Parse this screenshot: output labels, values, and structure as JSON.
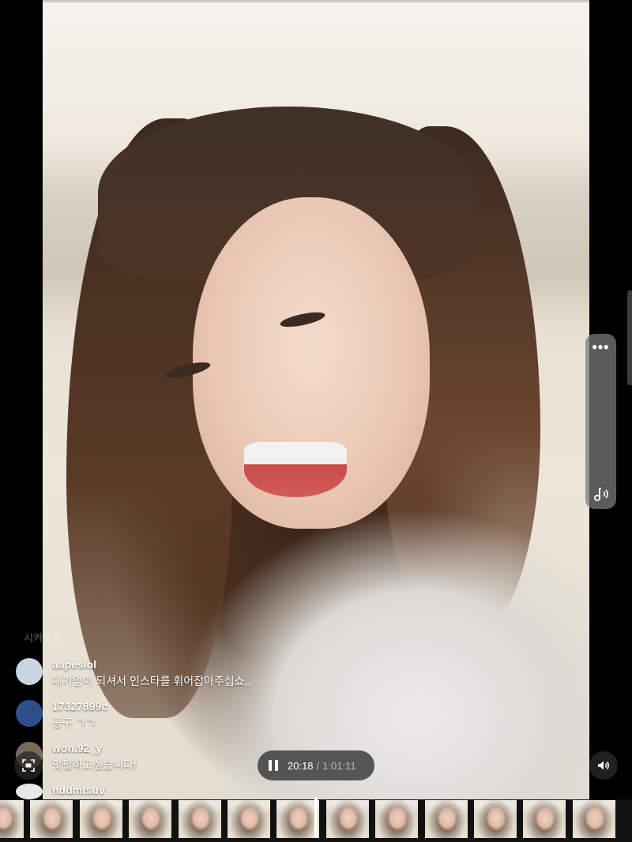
{
  "comments_faded": "시켜해요",
  "comments": [
    {
      "username": "aapeslol",
      "message": "대기업이 되셔서 인스타를 휘어잡아주십쇼,,",
      "avatar_color": "#c9d6e2"
    },
    {
      "username": "17327899c",
      "message": "공구 ㄱㄱ",
      "avatar_color": "#2f4f8a"
    },
    {
      "username": "won.92_y",
      "message": "맛팔하고싶습니다!",
      "avatar_color": "#7a6a5a"
    },
    {
      "username": "nddmtsuv",
      "message": "",
      "avatar_color": "#e8e8e8"
    }
  ],
  "player": {
    "current_time": "20:18",
    "separator": "/",
    "total_time": "1:01:11",
    "state": "playing"
  },
  "icons": {
    "more": "more-horizontal-icon",
    "music": "music-note-icon",
    "pip": "picture-in-picture-icon",
    "pause": "pause-icon",
    "volume": "volume-icon"
  },
  "colors": {
    "background": "#000000",
    "panel": "#787878",
    "pill": "#373737"
  },
  "filmstrip": {
    "thumbnail_count": 13,
    "scrubber_fraction": 0.33
  }
}
